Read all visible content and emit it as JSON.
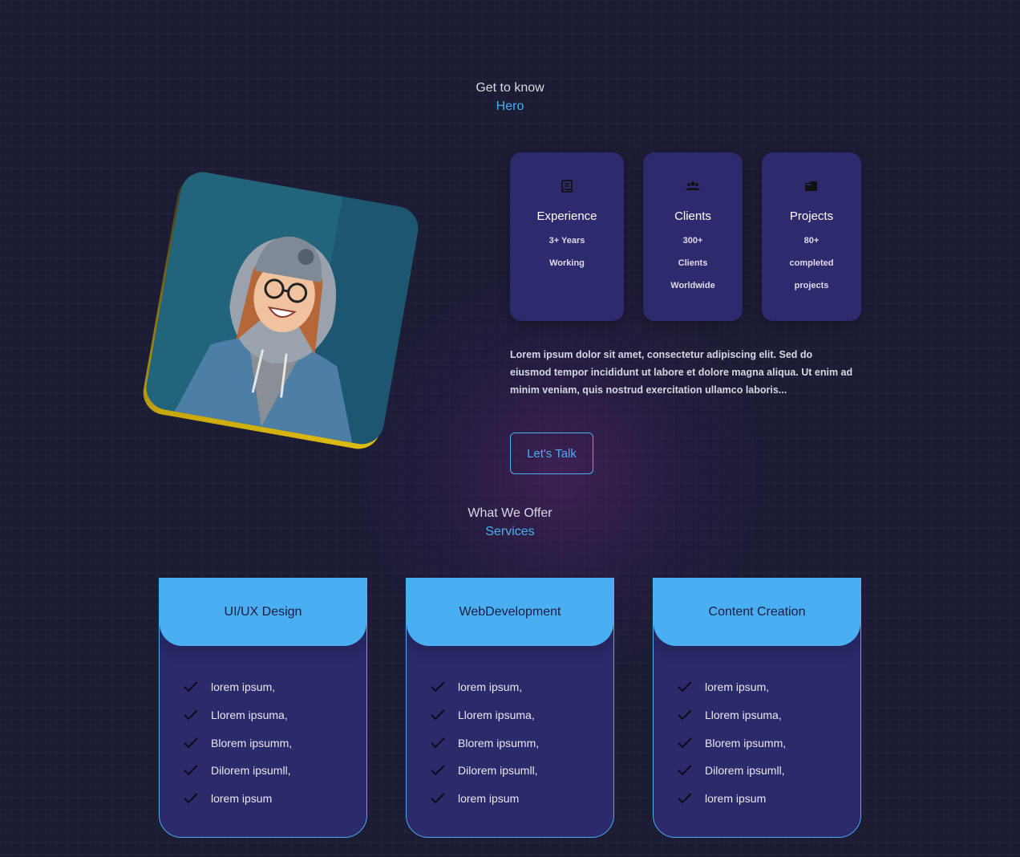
{
  "about_section": {
    "pre": "Get to know",
    "title": "Hero"
  },
  "stats": [
    {
      "icon": "book-icon",
      "title": "Experience",
      "lines": [
        "3+ Years",
        "Working"
      ]
    },
    {
      "icon": "users-icon",
      "title": "Clients",
      "lines": [
        "300+",
        "Clients",
        "Worldwide"
      ]
    },
    {
      "icon": "folder-icon",
      "title": "Projects",
      "lines": [
        "80+",
        "completed",
        "projects"
      ]
    }
  ],
  "about_text": "Lorem ipsum dolor sit amet, consectetur adipiscing elit. Sed do eiusmod tempor incididunt ut labore et dolore magna aliqua. Ut enim ad minim veniam, quis nostrud exercitation ullamco laboris...",
  "cta_label": "Let's Talk",
  "services_section": {
    "pre": "What We Offer",
    "title": "Services"
  },
  "services": [
    {
      "title": "UI/UX Design",
      "items": [
        "lorem ipsum,",
        "Llorem ipsuma,",
        "Blorem ipsumm,",
        "Dilorem ipsumll,",
        "lorem ipsum"
      ]
    },
    {
      "title": "WebDevelopment",
      "items": [
        "lorem ipsum,",
        "Llorem ipsuma,",
        "Blorem ipsumm,",
        "Dilorem ipsumll,",
        "lorem ipsum"
      ]
    },
    {
      "title": "Content Creation",
      "items": [
        "lorem ipsum,",
        "Llorem ipsuma,",
        "Blorem ipsumm,",
        "Dilorem ipsumll,",
        "lorem ipsum"
      ]
    }
  ],
  "colors": {
    "background": "#1c1c35",
    "accent": "#4aaef2",
    "card": "#2e2a6e",
    "photo_frame": "#e0bd10"
  }
}
